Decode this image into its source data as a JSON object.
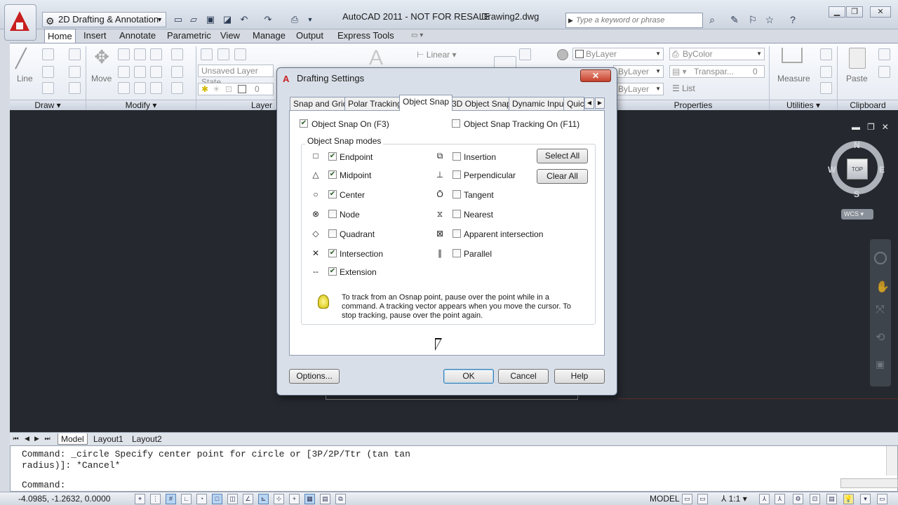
{
  "titlebar": {
    "workspace": "2D Drafting & Annotation",
    "app_title": "AutoCAD 2011 - NOT FOR RESALE",
    "doc_title": "Drawing2.dwg",
    "search_placeholder": "Type a keyword or phrase"
  },
  "ribbon_tabs": [
    "Home",
    "Insert",
    "Annotate",
    "Parametric",
    "View",
    "Manage",
    "Output",
    "Express Tools"
  ],
  "ribbon": {
    "draw_label": "Draw",
    "modify_label": "Modify",
    "layers_label": "Layer",
    "properties_label": "Properties",
    "utilities_label": "Utilities",
    "clipboard_label": "Clipboard",
    "line_label": "Line",
    "move_label": "Move",
    "layer_state": "Unsaved Layer State",
    "layer_value": "0",
    "linear": "Linear",
    "bylayer1": "ByLayer",
    "bycolor": "ByColor",
    "bylayer2": "ByLayer",
    "bylayer3": "ByLayer",
    "transparency": "Transpar...",
    "transparency_value": "0",
    "list": "List",
    "measure": "Measure",
    "paste": "Paste"
  },
  "viewcube": {
    "top": "TOP",
    "n": "N",
    "s": "S",
    "e": "E",
    "w": "W",
    "wcs": "WCS"
  },
  "layout_tabs": [
    "Model",
    "Layout1",
    "Layout2"
  ],
  "command": {
    "history": "Command: _circle Specify center point for circle or [3P/2P/Ttr (tan tan\nradius)]: *Cancel*",
    "prompt": "Command:"
  },
  "statusbar": {
    "coords": "-4.0985, -1.2632, 0.0000",
    "model": "MODEL",
    "scale": "1:1"
  },
  "dialog": {
    "title": "Drafting Settings",
    "tabs": [
      "Snap and Grid",
      "Polar Tracking",
      "Object Snap",
      "3D Object Snap",
      "Dynamic Input",
      "Quic"
    ],
    "snap_on": {
      "label": "Object Snap On (F3)",
      "checked": true
    },
    "tracking_on": {
      "label": "Object Snap Tracking On (F11)",
      "checked": false
    },
    "group_title": "Object Snap modes",
    "modes_left": [
      {
        "label": "Endpoint",
        "checked": true,
        "icon": "endpoint-icon",
        "glyph": "□"
      },
      {
        "label": "Midpoint",
        "checked": true,
        "icon": "midpoint-icon",
        "glyph": "△"
      },
      {
        "label": "Center",
        "checked": true,
        "icon": "center-icon",
        "glyph": "○"
      },
      {
        "label": "Node",
        "checked": false,
        "icon": "node-icon",
        "glyph": "⊗"
      },
      {
        "label": "Quadrant",
        "checked": false,
        "icon": "quadrant-icon",
        "glyph": "◇"
      },
      {
        "label": "Intersection",
        "checked": true,
        "icon": "intersection-icon",
        "glyph": "✕"
      },
      {
        "label": "Extension",
        "checked": true,
        "icon": "extension-icon",
        "glyph": "--"
      }
    ],
    "modes_right": [
      {
        "label": "Insertion",
        "checked": false,
        "icon": "insertion-icon",
        "glyph": "⧉"
      },
      {
        "label": "Perpendicular",
        "checked": false,
        "icon": "perpendicular-icon",
        "glyph": "⊥"
      },
      {
        "label": "Tangent",
        "checked": false,
        "icon": "tangent-icon",
        "glyph": "Ō"
      },
      {
        "label": "Nearest",
        "checked": false,
        "icon": "nearest-icon",
        "glyph": "⧖"
      },
      {
        "label": "Apparent intersection",
        "checked": false,
        "icon": "apparent-intersection-icon",
        "glyph": "⊠"
      },
      {
        "label": "Parallel",
        "checked": false,
        "icon": "parallel-icon",
        "glyph": "∥"
      }
    ],
    "select_all": "Select All",
    "clear_all": "Clear All",
    "tip": "To track from an Osnap point, pause over the point while in a command.  A tracking vector appears when you move the cursor. To stop tracking, pause over the point again.",
    "options": "Options...",
    "ok": "OK",
    "cancel": "Cancel",
    "help": "Help"
  },
  "colors": {
    "accent": "#c81e1e",
    "canvas": "#25292f",
    "dialog": "#d9dfe8"
  }
}
